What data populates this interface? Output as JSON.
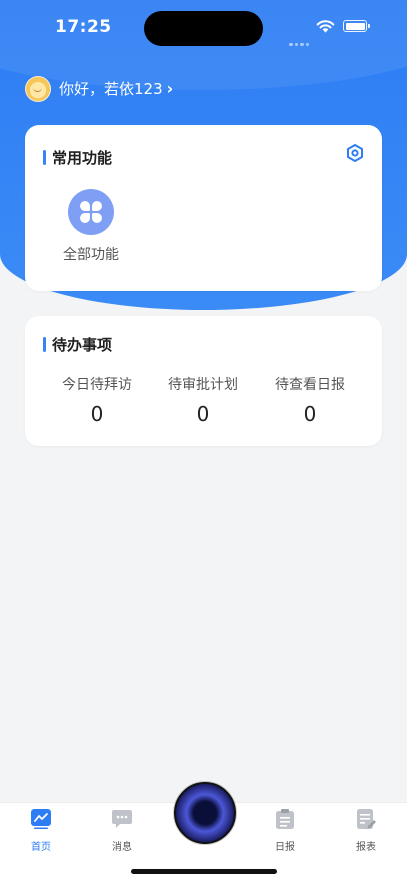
{
  "status_bar": {
    "time": "17:25"
  },
  "greeting": {
    "text": "你好，若依123",
    "chevron": "›"
  },
  "common_functions": {
    "title": "常用功能",
    "settings_icon": "settings-hexagon-icon",
    "items": [
      {
        "label": "全部功能",
        "icon": "four-leaf-grid-icon",
        "color": "#7e9ff3"
      }
    ]
  },
  "todo": {
    "title": "待办事项",
    "items": [
      {
        "label": "今日待拜访",
        "value": "0"
      },
      {
        "label": "待审批计划",
        "value": "0"
      },
      {
        "label": "待查看日报",
        "value": "0"
      }
    ]
  },
  "tabbar": {
    "tabs": [
      {
        "label": "首页",
        "icon": "home-chart-icon",
        "active": true
      },
      {
        "label": "消息",
        "icon": "message-icon",
        "active": false
      },
      {
        "label": "",
        "icon": "center-orb-icon",
        "active": false
      },
      {
        "label": "日报",
        "icon": "clipboard-icon",
        "active": false
      },
      {
        "label": "报表",
        "icon": "report-icon",
        "active": false
      }
    ]
  },
  "colors": {
    "primary": "#2d7df4",
    "accent_bar": "#3b82f6",
    "page_bg": "#f3f4f6"
  }
}
